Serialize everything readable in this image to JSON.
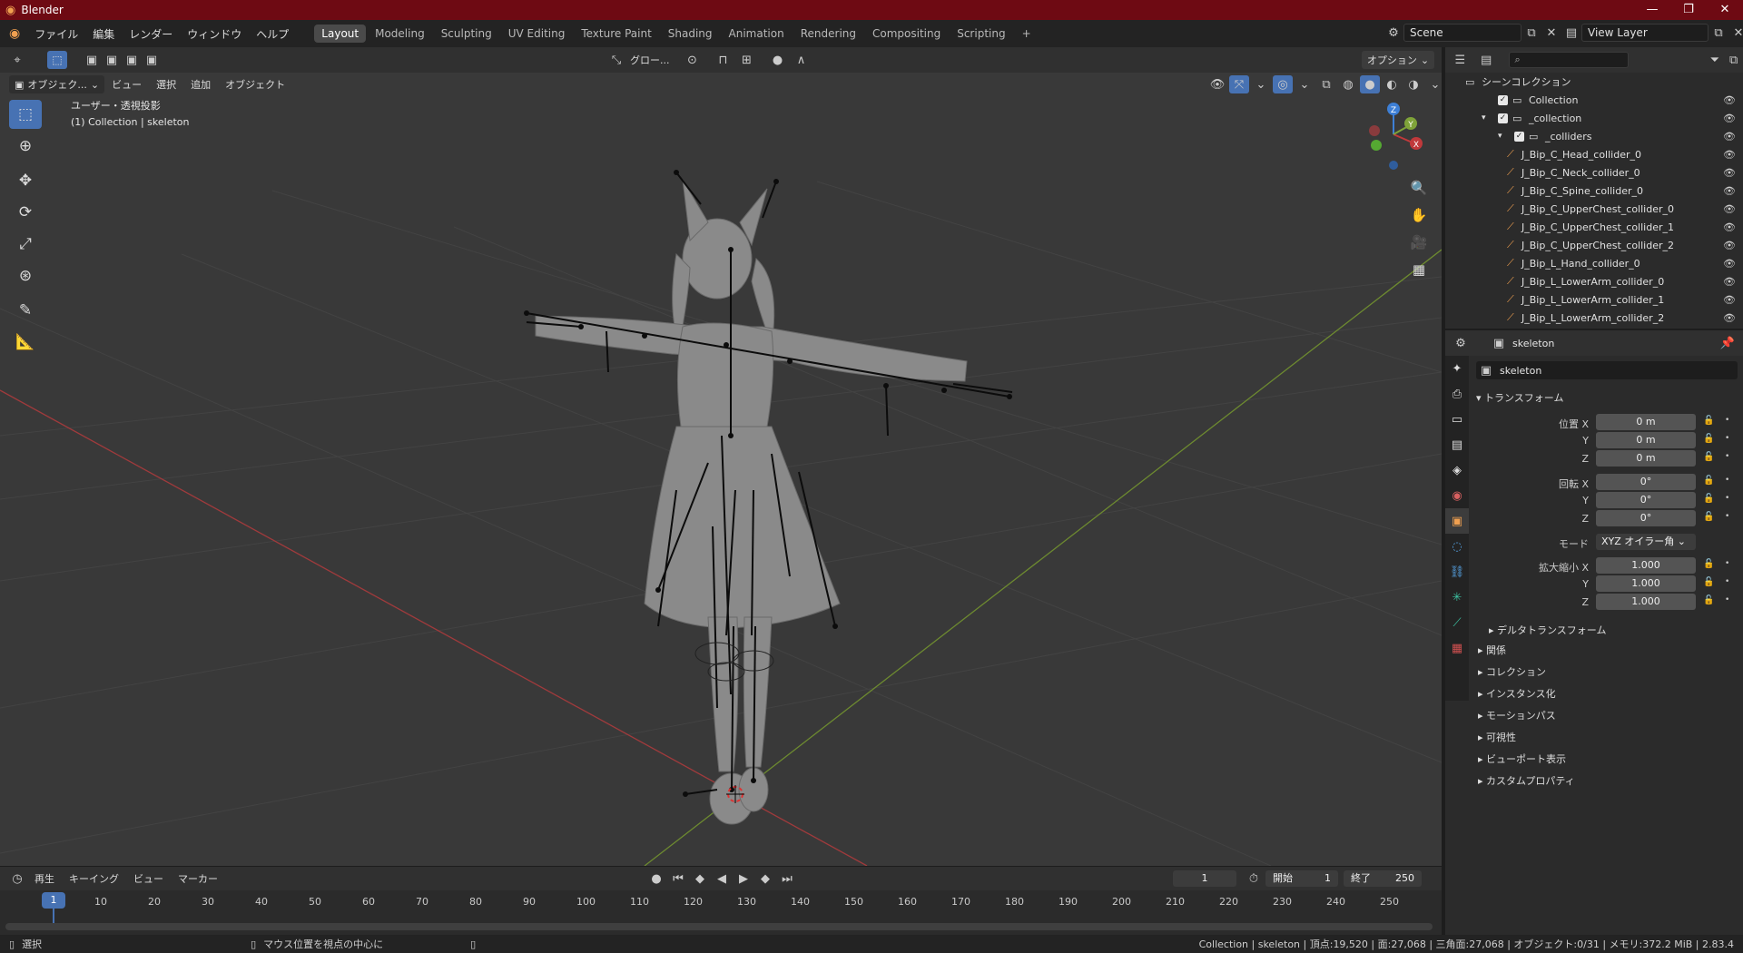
{
  "titlebar": {
    "app": "Blender",
    "minimize": "—",
    "maximize": "❐",
    "close": "✕"
  },
  "menus": [
    "ファイル",
    "編集",
    "レンダー",
    "ウィンドウ",
    "ヘルプ"
  ],
  "workspaces": [
    "Layout",
    "Modeling",
    "Sculpting",
    "UV Editing",
    "Texture Paint",
    "Shading",
    "Animation",
    "Rendering",
    "Compositing",
    "Scripting"
  ],
  "active_workspace": "Layout",
  "scene": {
    "label": "Scene",
    "view_layer": "View Layer"
  },
  "viewport_header": {
    "transform_orientation": "グロー...",
    "options": "オプション",
    "mode": "オブジェク...",
    "menu": [
      "ビュー",
      "選択",
      "追加",
      "オブジェクト"
    ]
  },
  "viewport": {
    "view_name": "ユーザー・透視投影",
    "collection_info": "(1) Collection | skeleton",
    "gizmo_axes": {
      "x": "X",
      "y": "Y",
      "z": "Z"
    }
  },
  "outliner": {
    "search_placeholder": "",
    "items": [
      {
        "label": "シーンコレクション",
        "indent": 0
      },
      {
        "label": "Collection",
        "indent": 1
      },
      {
        "label": "_collection",
        "indent": 1
      },
      {
        "label": "_colliders",
        "indent": 2
      },
      {
        "label": "J_Bip_C_Head_collider_0",
        "indent": 3
      },
      {
        "label": "J_Bip_C_Neck_collider_0",
        "indent": 3
      },
      {
        "label": "J_Bip_C_Spine_collider_0",
        "indent": 3
      },
      {
        "label": "J_Bip_C_UpperChest_collider_0",
        "indent": 3
      },
      {
        "label": "J_Bip_C_UpperChest_collider_1",
        "indent": 3
      },
      {
        "label": "J_Bip_C_UpperChest_collider_2",
        "indent": 3
      },
      {
        "label": "J_Bip_L_Hand_collider_0",
        "indent": 3
      },
      {
        "label": "J_Bip_L_LowerArm_collider_0",
        "indent": 3
      },
      {
        "label": "J_Bip_L_LowerArm_collider_1",
        "indent": 3
      },
      {
        "label": "J_Bip_L_LowerArm_collider_2",
        "indent": 3
      }
    ]
  },
  "properties": {
    "object_name": "skeleton",
    "datablock_name": "skeleton",
    "transform_header": "トランスフォーム",
    "location": {
      "label": "位置 X",
      "x": "0 m",
      "y": "0 m",
      "z": "0 m"
    },
    "rotation": {
      "label": "回転 X",
      "x": "0°",
      "y": "0°",
      "z": "0°"
    },
    "mode": {
      "label": "モード",
      "value": "XYZ オイラー角"
    },
    "scale": {
      "label": "拡大縮小 X",
      "x": "1.000",
      "y": "1.000",
      "z": "1.000"
    },
    "axis_y": "Y",
    "axis_z": "Z",
    "delta": "デルタトランスフォーム",
    "sections": [
      "関係",
      "コレクション",
      "インスタンス化",
      "モーションパス",
      "可視性",
      "ビューポート表示",
      "カスタムプロパティ"
    ]
  },
  "timeline": {
    "menu": [
      "再生",
      "キーイング",
      "ビュー",
      "マーカー"
    ],
    "current_frame": "1",
    "start_label": "開始",
    "start": "1",
    "end_label": "終了",
    "end": "250",
    "ticks": [
      "10",
      "20",
      "30",
      "40",
      "50",
      "60",
      "70",
      "80",
      "90",
      "100",
      "110",
      "120",
      "130",
      "140",
      "150",
      "160",
      "170",
      "180",
      "190",
      "200",
      "210",
      "220",
      "230",
      "240",
      "250"
    ],
    "playhead": "1"
  },
  "statusbar": {
    "left": "選択",
    "middle": "マウス位置を視点の中心に",
    "right": "Collection | skeleton | 頂点:19,520 | 面:27,068 | 三角面:27,068 | オブジェクト:0/31 | メモリ:372.2 MiB | 2.83.4"
  },
  "colors": {
    "accent": "#4772b3",
    "titlebar": "#6e0a13",
    "x_axis": "#c0393b",
    "y_axis": "#7fa339",
    "z_axis": "#3d7fd6"
  }
}
